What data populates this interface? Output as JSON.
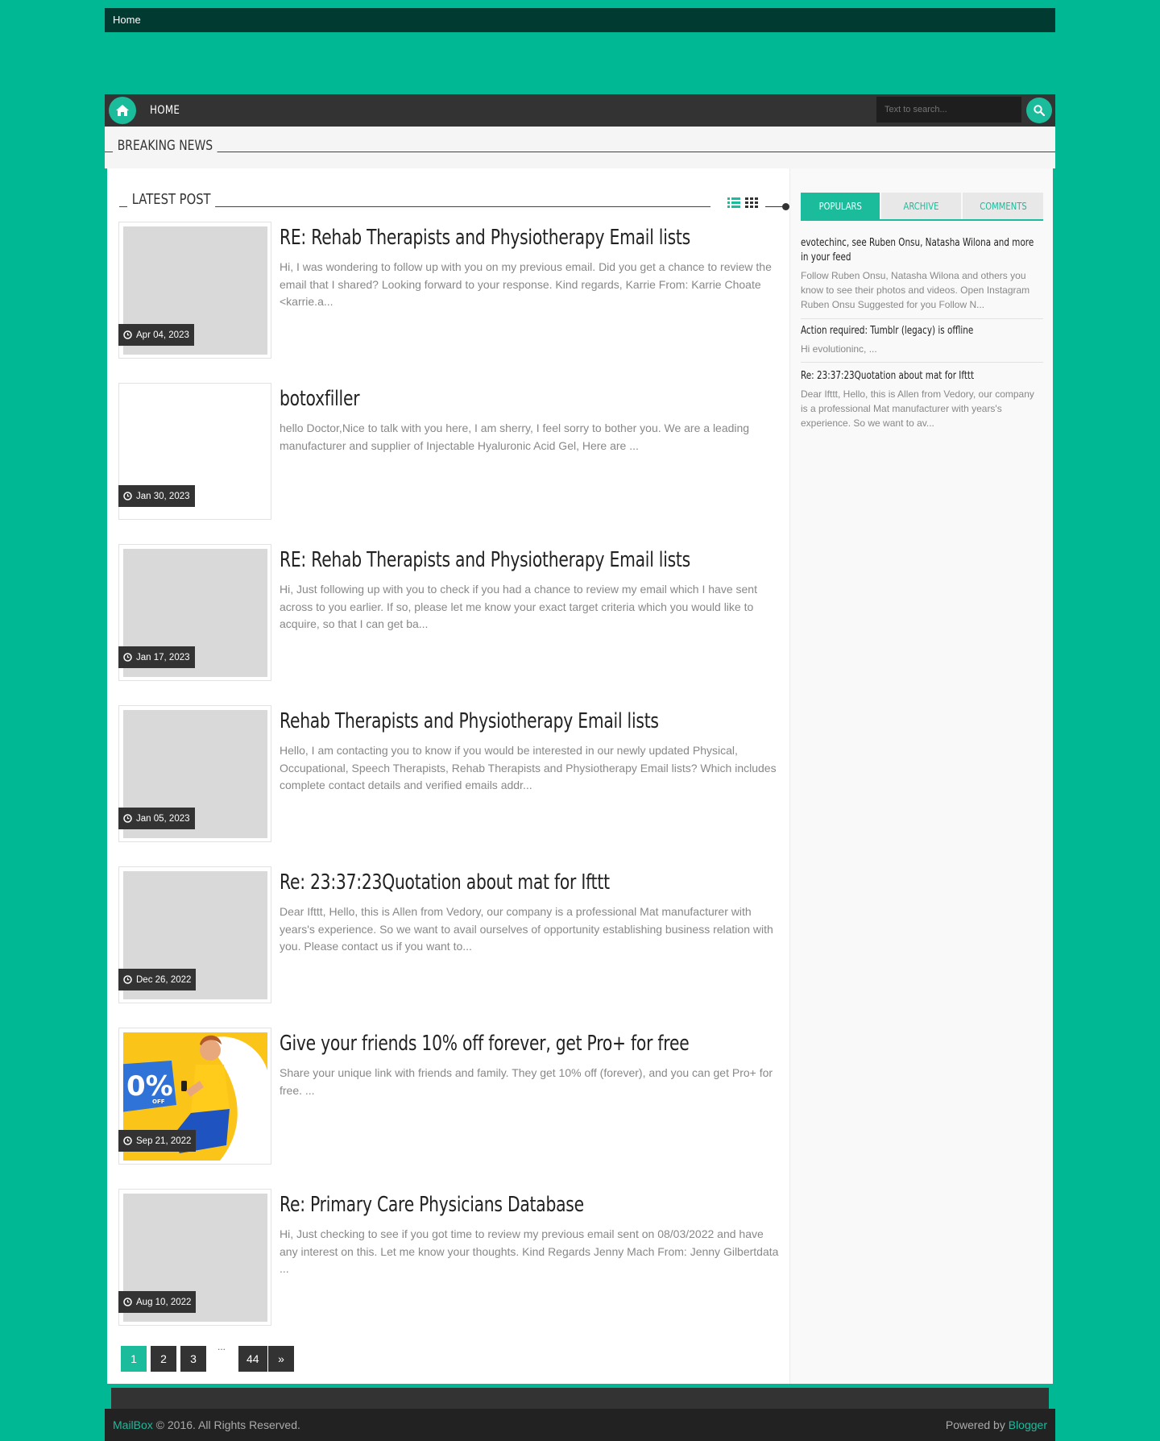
{
  "colors": {
    "accent": "#1abc9c",
    "background": "#00b894",
    "dark": "#333333"
  },
  "topbar": {
    "home_link": "Home"
  },
  "nav": {
    "home_label": "HOME",
    "search_placeholder": "Text to search..."
  },
  "breaking": {
    "label": "BREAKING NEWS"
  },
  "latest": {
    "title": "LATEST POST"
  },
  "posts": [
    {
      "title": "RE: Rehab Therapists and Physiotherapy Email lists",
      "excerpt": "Hi,   I was wondering to follow up with you on my previous email. Did you get a chance to review the email that I shared?   Looking forward to your response.   Kind regards, Karrie From: Karrie Choate <karrie.a...",
      "date": "Apr 04, 2023"
    },
    {
      "title": "botoxfiller",
      "excerpt": "hello Doctor,Nice to talk with you here, I am sherry, I feel sorry to bother you. We are a leading manufacturer and supplier of  Injectable Hyaluronic Acid Gel, Here are ...",
      "date": "Jan 30, 2023"
    },
    {
      "title": "RE: Rehab Therapists and Physiotherapy Email lists",
      "excerpt": "Hi,   Just following up with you to check if you had a chance to review my email which I have sent across to you earlier.   If so, please let me know your exact target criteria which you would like to acquire, so that I can get ba...",
      "date": "Jan 17, 2023"
    },
    {
      "title": "Rehab Therapists and Physiotherapy Email lists",
      "excerpt": "Hello,   I am contacting you to know if you would be interested in our newly updated Physical, Occupational, Speech Therapists, Rehab Therapists and Physiotherapy Email lists? Which includes complete contact details and verified emails addr...",
      "date": "Jan 05, 2023"
    },
    {
      "title": "Re: 23:37:23Quotation about mat for Ifttt",
      "excerpt": "Dear Ifttt, Hello, this is Allen from Vedory, our company is a professional Mat manufacturer with years's experience. So we want to avail ourselves of opportunity establishing business relation with you. Please contact us if you want to...",
      "date": "Dec 26, 2022"
    },
    {
      "title": "Give your friends 10% off forever, get Pro+ for free",
      "excerpt": "Share your unique link with friends and family. They get 10% off (forever), and you can get Pro+ for free.     ...",
      "date": "Sep 21, 2022",
      "thumb_badge": "0%",
      "thumb_badge_sub": "OFF"
    },
    {
      "title": "Re: Primary Care Physicians Database",
      "excerpt": "Hi,   Just checking to see if you got time to review my previous email sent on 08/03/2022 and have any interest on this. Let me know your thoughts.   Kind Regards Jenny Mach     From: Jenny Gilbertdata ...",
      "date": "Aug 10, 2022"
    }
  ],
  "pagination": {
    "pages": [
      "1",
      "2",
      "3",
      "44"
    ],
    "dots": "...",
    "next": "»"
  },
  "sidebar": {
    "tabs": [
      "POPULARS",
      "ARCHIVE",
      "COMMENTS"
    ],
    "popular": [
      {
        "title": "evotechinc, see Ruben Onsu, Natasha Wilona and more in your feed",
        "text": "  Follow Ruben Onsu, Natasha Wilona and others you know to see their photos and videos. Open Instagram Ruben Onsu Suggested for you Follow N..."
      },
      {
        "title": "Action required: Tumblr (legacy) is offline",
        "text": "Hi evolutioninc, ..."
      },
      {
        "title": "Re: 23:37:23Quotation about mat for Ifttt",
        "text": "Dear Ifttt, Hello, this is Allen from Vedory, our company is a professional Mat manufacturer with years's experience. So we want to av..."
      }
    ]
  },
  "footer": {
    "brand": "MailBox",
    "copyright": " © 2016. All Rights Reserved.",
    "powered_prefix": "Powered by ",
    "powered_link": "Blogger"
  }
}
